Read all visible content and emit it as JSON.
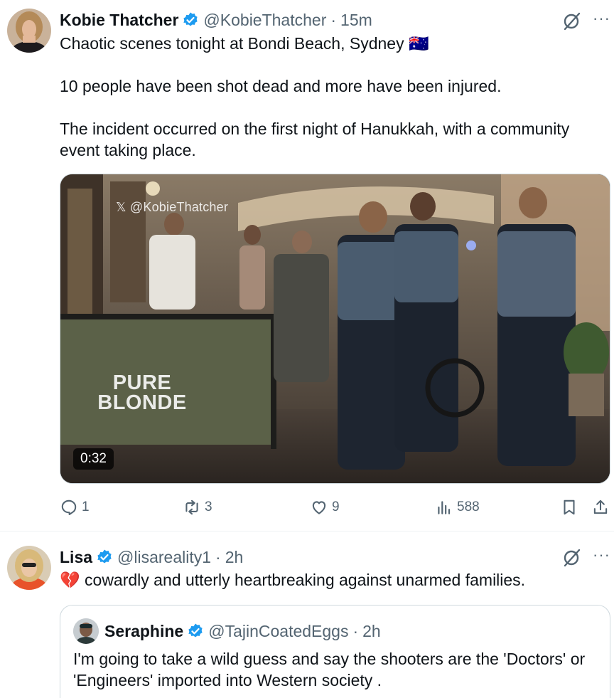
{
  "post": {
    "display_name": "Kobie Thatcher",
    "handle": "@KobieThatcher",
    "timestamp": "15m",
    "paragraphs": [
      "Chaotic scenes tonight at Bondi Beach, Sydney 🇦🇺",
      "10 people have been shot dead and more have been injured.",
      "The incident occurred on the first night of Hanukkah, with a community event taking place."
    ],
    "media": {
      "watermark": "@KobieThatcher",
      "duration": "0:32",
      "banner_line1": "PURE",
      "banner_line2": "BLONDE"
    },
    "actions": {
      "replies": "1",
      "reposts": "3",
      "likes": "9",
      "views": "588"
    }
  },
  "reply": {
    "display_name": "Lisa",
    "handle": "@lisareality1",
    "timestamp": "2h",
    "text": "cowardly and utterly heartbreaking against unarmed families.",
    "emoji": "💔",
    "quote": {
      "display_name": "Seraphine",
      "handle": "@TajinCoatedEggs",
      "timestamp": "2h",
      "text": "I'm going to take a wild guess and say the shooters are the 'Doctors' or 'Engineers' imported into Western society ."
    }
  },
  "colors": {
    "text_primary": "#0f1419",
    "text_secondary": "#536471",
    "verified_blue": "#1d9bf0",
    "border": "#cfd9de"
  },
  "icons": [
    "verified-badge-icon",
    "grok-icon",
    "more-icon",
    "reply-icon",
    "repost-icon",
    "like-icon",
    "views-icon",
    "bookmark-icon",
    "share-icon"
  ]
}
